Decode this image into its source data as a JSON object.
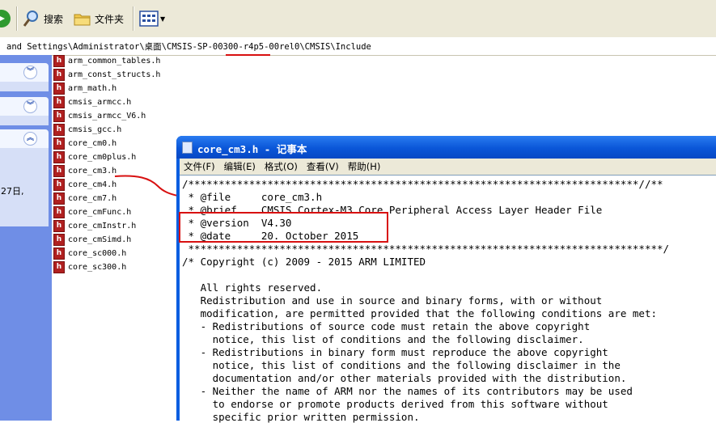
{
  "toolbar": {
    "search_label": "搜索",
    "folders_label": "文件夹"
  },
  "address": {
    "path": "and Settings\\Administrator\\桌面\\CMSIS-SP-00300-r4p5-00rel0\\CMSIS\\Include"
  },
  "taskpane": {
    "fragment_text": "27日,"
  },
  "files": [
    "arm_common_tables.h",
    "arm_const_structs.h",
    "arm_math.h",
    "cmsis_armcc.h",
    "cmsis_armcc_V6.h",
    "cmsis_gcc.h",
    "core_cm0.h",
    "core_cm0plus.h",
    "core_cm3.h",
    "core_cm4.h",
    "core_cm7.h",
    "core_cmFunc.h",
    "core_cmInstr.h",
    "core_cmSimd.h",
    "core_sc000.h",
    "core_sc300.h"
  ],
  "notepad": {
    "title": "core_cm3.h - 记事本",
    "menu": [
      "文件(F)",
      "编辑(E)",
      "格式(O)",
      "查看(V)",
      "帮助(H)"
    ],
    "lines": [
      "/**************************************************************************//**",
      " * @file     core_cm3.h",
      " * @brief    CMSIS Cortex-M3 Core Peripheral Access Layer Header File",
      " * @version  V4.30",
      " * @date     20. October 2015",
      " ******************************************************************************/",
      "/* Copyright (c) 2009 - 2015 ARM LIMITED",
      "",
      "   All rights reserved.",
      "   Redistribution and use in source and binary forms, with or without",
      "   modification, are permitted provided that the following conditions are met:",
      "   - Redistributions of source code must retain the above copyright",
      "     notice, this list of conditions and the following disclaimer.",
      "   - Redistributions in binary form must reproduce the above copyright",
      "     notice, this list of conditions and the following disclaimer in the",
      "     documentation and/or other materials provided with the distribution.",
      "   - Neither the name of ARM nor the names of its contributors may be used",
      "     to endorse or promote products derived from this software without",
      "     specific prior written permission."
    ]
  },
  "colors": {
    "annotation_red": "#d81010",
    "titlebar_blue": "#0a56d8",
    "taskpane_blue": "#6f8ee6"
  }
}
